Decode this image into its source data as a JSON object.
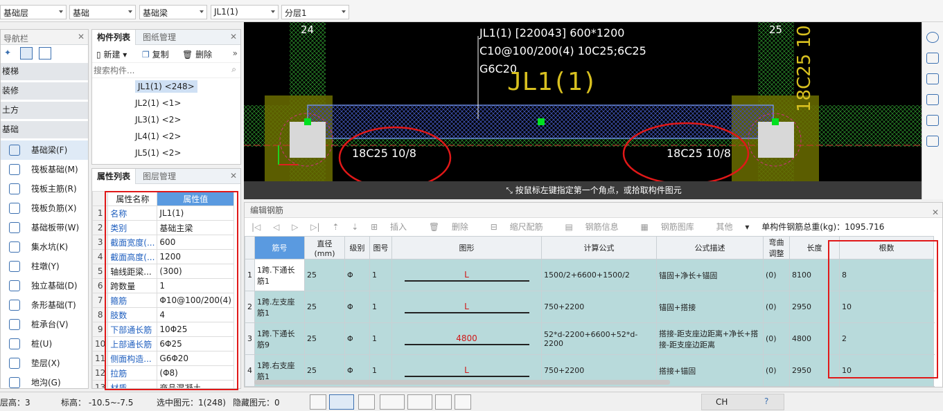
{
  "toolbar": {
    "selects": [
      "基础层",
      "基础",
      "基础梁",
      "JL1(1)",
      "分层1"
    ]
  },
  "nav": {
    "title": "导航栏",
    "categories": [
      "楼梯",
      "装修",
      "土方",
      "基础"
    ],
    "items": [
      {
        "label": "基础梁(F)",
        "icon": "beam-icon"
      },
      {
        "label": "筏板基础(M)",
        "icon": "raft-icon"
      },
      {
        "label": "筏板主筋(R)",
        "icon": "rebar-main-icon"
      },
      {
        "label": "筏板负筋(X)",
        "icon": "rebar-neg-icon"
      },
      {
        "label": "基础板带(W)",
        "icon": "slab-band-icon"
      },
      {
        "label": "集水坑(K)",
        "icon": "sump-icon"
      },
      {
        "label": "柱墩(Y)",
        "icon": "pier-icon"
      },
      {
        "label": "独立基础(D)",
        "icon": "isolated-footing-icon"
      },
      {
        "label": "条形基础(T)",
        "icon": "strip-footing-icon"
      },
      {
        "label": "桩承台(V)",
        "icon": "pile-cap-icon"
      },
      {
        "label": "桩(U)",
        "icon": "pile-icon"
      },
      {
        "label": "垫层(X)",
        "icon": "cushion-icon"
      },
      {
        "label": "地沟(G)",
        "icon": "trench-icon"
      }
    ]
  },
  "components": {
    "tabs": [
      "构件列表",
      "图纸管理"
    ],
    "new_label": "新建",
    "copy_label": "复制",
    "delete_label": "删除",
    "search_placeholder": "搜索构件...",
    "items": [
      "JL1(1) <248>",
      "JL2(1) <1>",
      "JL3(1) <2>",
      "JL4(1) <2>",
      "JL5(1) <2>"
    ]
  },
  "properties": {
    "tabs": [
      "属性列表",
      "图层管理"
    ],
    "header_name": "属性名称",
    "header_value": "属性值",
    "rows": [
      {
        "n": "1",
        "name": "名称",
        "value": "JL1(1)"
      },
      {
        "n": "2",
        "name": "类别",
        "value": "基础主梁"
      },
      {
        "n": "3",
        "name": "截面宽度(...",
        "value": "600"
      },
      {
        "n": "4",
        "name": "截面高度(...",
        "value": "1200"
      },
      {
        "n": "5",
        "name": "轴线距梁...",
        "value": "(300)"
      },
      {
        "n": "6",
        "name": "跨数量",
        "value": "1"
      },
      {
        "n": "7",
        "name": "箍筋",
        "value": "Φ10@100/200(4)"
      },
      {
        "n": "8",
        "name": "肢数",
        "value": "4"
      },
      {
        "n": "9",
        "name": "下部通长筋",
        "value": "10Φ25"
      },
      {
        "n": "10",
        "name": "上部通长筋",
        "value": "6Φ25"
      },
      {
        "n": "11",
        "name": "侧面构造...",
        "value": "G6Φ20"
      },
      {
        "n": "12",
        "name": "拉筋",
        "value": "(Φ8)"
      },
      {
        "n": "13",
        "name": "材质",
        "value": "商品混凝土"
      }
    ]
  },
  "cad": {
    "axis_left": "24",
    "axis_right": "25",
    "axis_left_bottom": "24",
    "axis_right_bottom": "25",
    "label_line1": "JL1(1) [220043] 600*1200",
    "label_line2": "C10@100/200(4) 10C25;6C25",
    "label_line3": "G6C20",
    "yellow_label": "JL1(1)",
    "vertical_label": "18C25 10",
    "rebar_left": "18C25 10/8",
    "rebar_right": "18C25 10/8",
    "hint": "按鼠标左键指定第一个角点，或拾取构件图元"
  },
  "rebar_editor": {
    "title": "编辑钢筋",
    "toolbar": [
      "插入",
      "删除",
      "缩尺配筋",
      "钢筋信息",
      "钢筋图库",
      "其他"
    ],
    "total_label": "单构件钢筋总重(kg)：1095.716",
    "columns": [
      "筋号",
      "直径(mm)",
      "级别",
      "图号",
      "图形",
      "计算公式",
      "公式描述",
      "弯曲调整",
      "长度",
      "根数"
    ],
    "rows": [
      {
        "n": "1",
        "name": "1跨.下通长筋1",
        "dia": "25",
        "grade": "Φ",
        "fig": "1",
        "shape": "L",
        "formula": "1500/2+6600+1500/2",
        "desc": "锚固+净长+锚固",
        "bend": "(0)",
        "len": "8100",
        "count": "8"
      },
      {
        "n": "2",
        "name": "1跨.左支座筋1",
        "dia": "25",
        "grade": "Φ",
        "fig": "1",
        "shape": "L",
        "formula": "750+2200",
        "desc": "锚固+搭接",
        "bend": "(0)",
        "len": "2950",
        "count": "10"
      },
      {
        "n": "3",
        "name": "1跨.下通长筋9",
        "dia": "25",
        "grade": "Φ",
        "fig": "1",
        "shape": "4800",
        "formula": "52*d-2200+6600+52*d-2200",
        "desc": "搭接-距支座边距离+净长+搭接-距支座边距离",
        "bend": "(0)",
        "len": "4800",
        "count": "2"
      },
      {
        "n": "4",
        "name": "1跨.右支座筋1",
        "dia": "25",
        "grade": "Φ",
        "fig": "1",
        "shape": "L",
        "formula": "750+2200",
        "desc": "搭接+锚固",
        "bend": "(0)",
        "len": "2950",
        "count": "10"
      }
    ]
  },
  "status": {
    "floor": "层高：3",
    "elev": "标高：  -10.5~-7.5",
    "selected": "选中图元：1(248)",
    "hidden": "隐藏图元：0",
    "ime": "CH"
  }
}
